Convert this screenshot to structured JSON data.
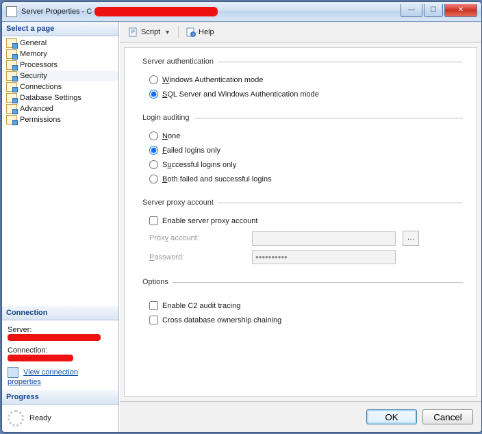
{
  "window": {
    "title_prefix": "Server Properties - C"
  },
  "toolbar": {
    "script": "Script",
    "help": "Help"
  },
  "sidebar": {
    "select_page": "Select a page",
    "items": [
      {
        "label": "General"
      },
      {
        "label": "Memory"
      },
      {
        "label": "Processors"
      },
      {
        "label": "Security"
      },
      {
        "label": "Connections"
      },
      {
        "label": "Database Settings"
      },
      {
        "label": "Advanced"
      },
      {
        "label": "Permissions"
      }
    ],
    "connection_hdr": "Connection",
    "server_lbl": "Server:",
    "connection_lbl": "Connection:",
    "view_conn": "View connection properties",
    "progress_hdr": "Progress",
    "ready": "Ready"
  },
  "auth": {
    "legend": "Server authentication",
    "win_mode": "Windows Authentication mode",
    "mixed_mode": "SQL Server and Windows Authentication mode",
    "selected": "mixed"
  },
  "audit": {
    "legend": "Login auditing",
    "none": "None",
    "failed": "Failed logins only",
    "success": "Successful logins only",
    "both": "Both failed and successful logins",
    "selected": "failed"
  },
  "proxy": {
    "legend": "Server proxy account",
    "enable": "Enable server proxy account",
    "account_lbl": "Proxy account:",
    "password_lbl": "Password:",
    "account_val": "",
    "password_val": "**********",
    "enabled": false
  },
  "options": {
    "legend": "Options",
    "c2": "Enable C2 audit tracing",
    "cross": "Cross database ownership chaining",
    "c2_checked": false,
    "cross_checked": false
  },
  "footer": {
    "ok": "OK",
    "cancel": "Cancel"
  }
}
